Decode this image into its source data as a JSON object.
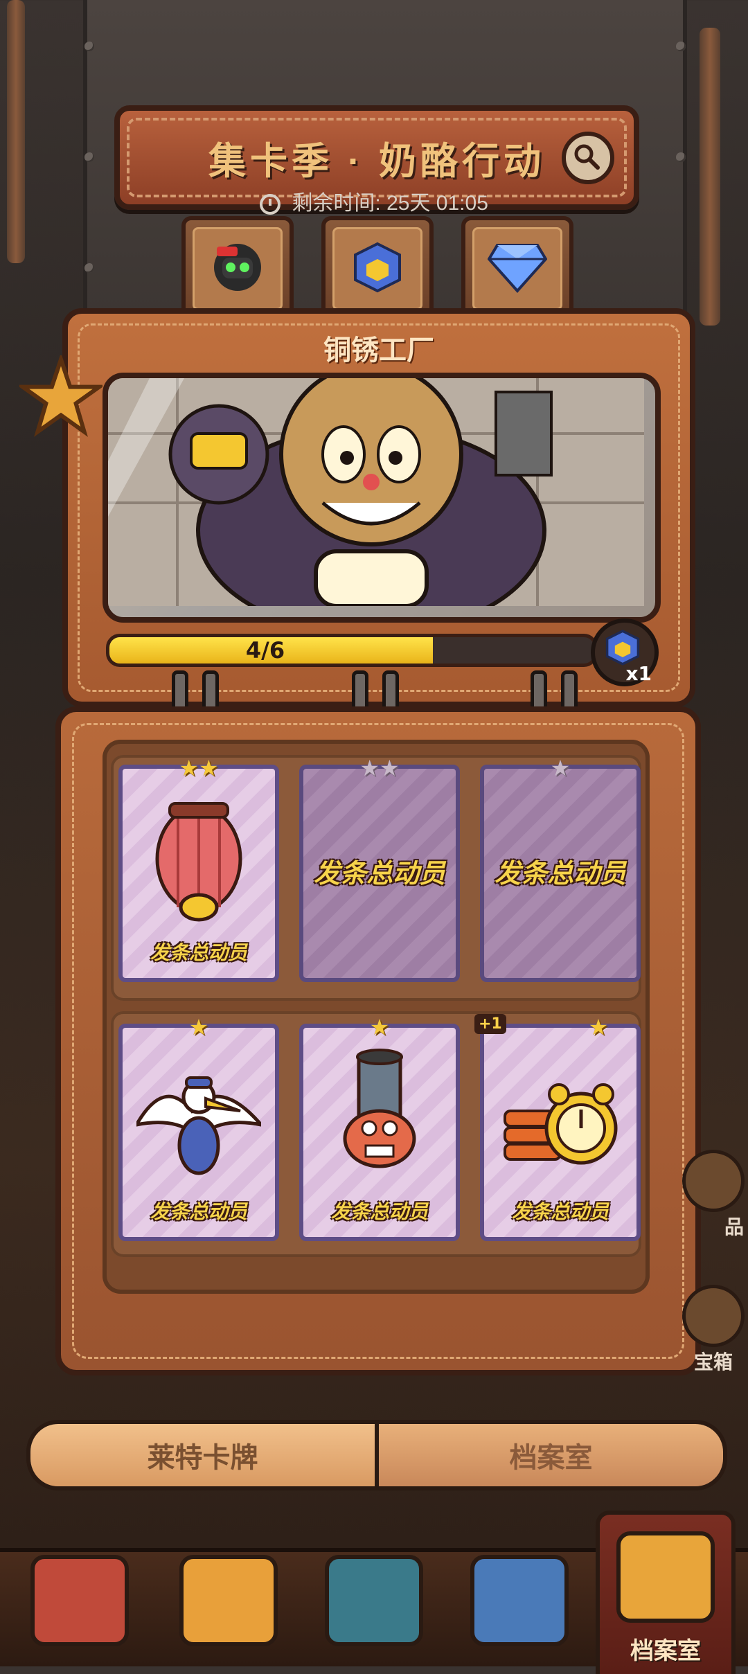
{
  "header": {
    "title": "集卡季 · 奶酪行动",
    "timer_label": "剩余时间: 25天 01:05"
  },
  "album": {
    "title": "铜锈工厂",
    "progress_text": "4/6",
    "progress_fraction": 0.667,
    "reward_qty": "x1"
  },
  "cards": [
    {
      "stars": "★★",
      "collected": true,
      "logo": "发条总动员",
      "art": "zeppelin-icon"
    },
    {
      "stars": "★★",
      "collected": false,
      "logo": "发条总动员",
      "art": "locked"
    },
    {
      "stars": "★",
      "collected": false,
      "logo": "发条总动员",
      "art": "locked"
    },
    {
      "stars": "★",
      "collected": true,
      "logo": "发条总动员",
      "art": "bird-icon"
    },
    {
      "stars": "★",
      "collected": true,
      "logo": "发条总动员",
      "art": "cannon-icon"
    },
    {
      "stars": "★",
      "collected": true,
      "logo": "发条总动员",
      "art": "alarm-dynamite-icon",
      "badge": "+1"
    }
  ],
  "side": {
    "chest_label": "宝箱",
    "partial_label": "品"
  },
  "tabs": [
    {
      "label": "莱特卡牌",
      "active": true
    },
    {
      "label": "档案室",
      "active": false
    }
  ],
  "bottom_nav": {
    "active_label": "档案室"
  },
  "colors": {
    "leather": "#b86a3b",
    "dark_outline": "#3a1e14",
    "progress_fill": "#f4c730",
    "card_purple": "#e6cde6",
    "star_gold": "#f6c93b"
  }
}
